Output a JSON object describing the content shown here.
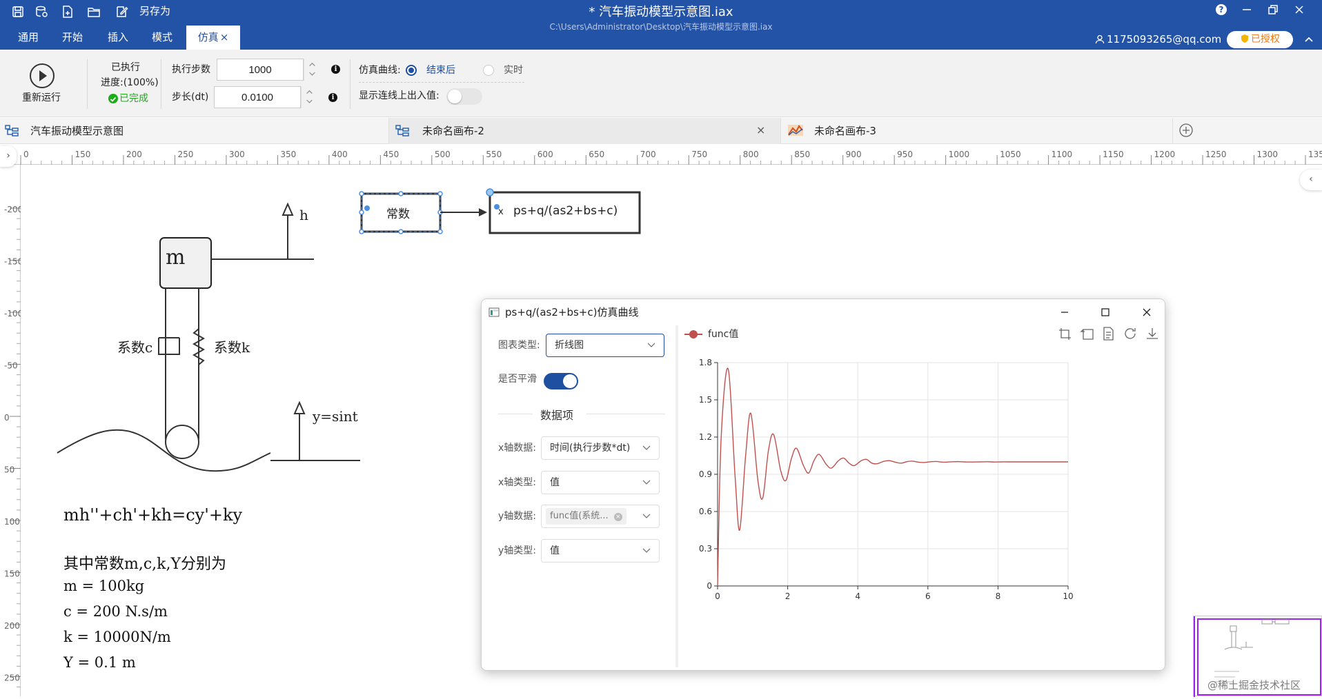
{
  "app": {
    "document_title": "*  汽车振动模型示意图.iax",
    "document_path": "C:\\Users\\Administrator\\Desktop\\汽车振动模型示意图.iax",
    "save_as_label": "另存为",
    "menu_tabs": [
      "通用",
      "开始",
      "插入",
      "模式",
      "仿真"
    ],
    "active_tab_close": "×",
    "user_email": "1175093265@qq.com",
    "license_label": "已授权",
    "help_glyph": "?",
    "colors": {
      "title_bar": "#2353a6",
      "accent": "#1f4fa0",
      "success": "#1aad19",
      "license": "#e87d1e",
      "curve": "#c0504d"
    }
  },
  "ribbon": {
    "rerun_label": "重新运行",
    "executed_label": "已执行",
    "progress_label": "进度:(100%)",
    "progress_percent": 100,
    "status_label": "已完成",
    "steps_label": "执行步数",
    "steps_value": "1000",
    "dt_label": "步长(dt)",
    "dt_value": "0.0100",
    "curve_label": "仿真曲线:",
    "curve_option_after": "结束后",
    "curve_option_realtime": "实时",
    "curve_selected": "结束后",
    "show_io_label": "显示连线上出入值:",
    "show_io_on": false,
    "info_glyph": "i"
  },
  "doc_tabs": [
    {
      "label": "汽车振动模型示意图",
      "icon": "flow-icon"
    },
    {
      "label": "未命名画布-2",
      "icon": "flow-icon",
      "close": "×"
    },
    {
      "label": "未命名画布-3",
      "icon": "chart-icon"
    }
  ],
  "rulers": {
    "top_ticks": [
      "0",
      "150",
      "200",
      "250",
      "300",
      "350",
      "400",
      "450",
      "500",
      "550",
      "600",
      "650",
      "700",
      "750",
      "800",
      "850",
      "900",
      "950",
      "1000",
      "1050",
      "1100",
      "1150",
      "1200",
      "1250",
      "1300",
      "1350"
    ],
    "left_ticks": [
      "-200",
      "-150",
      "-100",
      "-50",
      "0",
      "50",
      "100",
      "150",
      "200",
      "250"
    ]
  },
  "diagram": {
    "mass_label": "m",
    "h_label": "h",
    "c_label": "系数c",
    "k_label": "系数k",
    "y_label": "y=sint",
    "block_constant": "常数",
    "block_tf": "ps+q/(as2+bs+c)",
    "block_tf_port": "x",
    "equation": "mh''+ch'+kh=cy'+ky",
    "params_heading": "其中常数m,c,k,Y分别为",
    "params": [
      "m = 100kg",
      "c = 200 N.s/m",
      "k = 10000N/m",
      "Y = 0.1 m"
    ]
  },
  "popup": {
    "title": "ps+q/(as2+bs+c)仿真曲线",
    "chart_type_label": "图表类型:",
    "chart_type_value": "折线图",
    "smooth_label": "是否平滑",
    "smooth_on": true,
    "data_section": "数据项",
    "x_data_label": "x轴数据:",
    "x_data_value": "时间(执行步数*dt)",
    "x_type_label": "x轴类型:",
    "x_type_value": "值",
    "y_data_label": "y轴数据:",
    "y_data_value": "func值(系统...",
    "y_type_label": "y轴类型:",
    "y_type_value": "值"
  },
  "chart_data": {
    "type": "line",
    "title": "",
    "xlabel": "",
    "ylabel": "",
    "xlim": [
      0,
      10
    ],
    "ylim": [
      0,
      1.8
    ],
    "x_ticks": [
      "0",
      "2",
      "4",
      "6",
      "8",
      "10"
    ],
    "y_ticks": [
      "0",
      "0.3",
      "0.6",
      "0.9",
      "1.2",
      "1.5",
      "1.8"
    ],
    "grid": true,
    "legend_position": "top-left",
    "series": [
      {
        "name": "func值",
        "color": "#c0504d",
        "x": [
          0,
          0.1,
          0.3,
          0.5,
          0.63,
          0.8,
          0.95,
          1.15,
          1.29,
          1.45,
          1.6,
          1.8,
          1.95,
          2.1,
          2.25,
          2.45,
          2.6,
          2.75,
          2.9,
          3.1,
          3.25,
          3.45,
          3.6,
          3.75,
          3.9,
          4.1,
          4.25,
          4.4,
          4.55,
          4.75,
          4.9,
          5.1,
          5.25,
          5.4,
          5.55,
          5.75,
          5.9,
          6.1,
          6.25,
          6.4,
          6.55,
          6.7,
          6.9,
          7.1,
          7.3,
          7.5,
          7.7,
          7.9,
          8.1,
          8.3,
          8.6,
          9.0,
          9.5,
          10.0
        ],
        "y": [
          0,
          1.18,
          1.75,
          0.88,
          0.45,
          1.05,
          1.39,
          0.85,
          0.71,
          1.09,
          1.22,
          0.93,
          0.85,
          1.02,
          1.11,
          0.97,
          0.91,
          1.01,
          1.06,
          0.98,
          0.95,
          1.01,
          1.03,
          0.99,
          0.97,
          1.01,
          1.02,
          0.99,
          0.985,
          1.005,
          1.01,
          0.995,
          0.99,
          1.002,
          1.006,
          0.997,
          0.995,
          1.002,
          1.003,
          0.998,
          0.998,
          1.001,
          1.002,
          0.999,
          0.999,
          1.0,
          1.001,
          0.999,
          1.0,
          1.0,
          1.0,
          1.0,
          1.0,
          1.0
        ]
      }
    ]
  },
  "watermark": "@稀土掘金技术社区"
}
